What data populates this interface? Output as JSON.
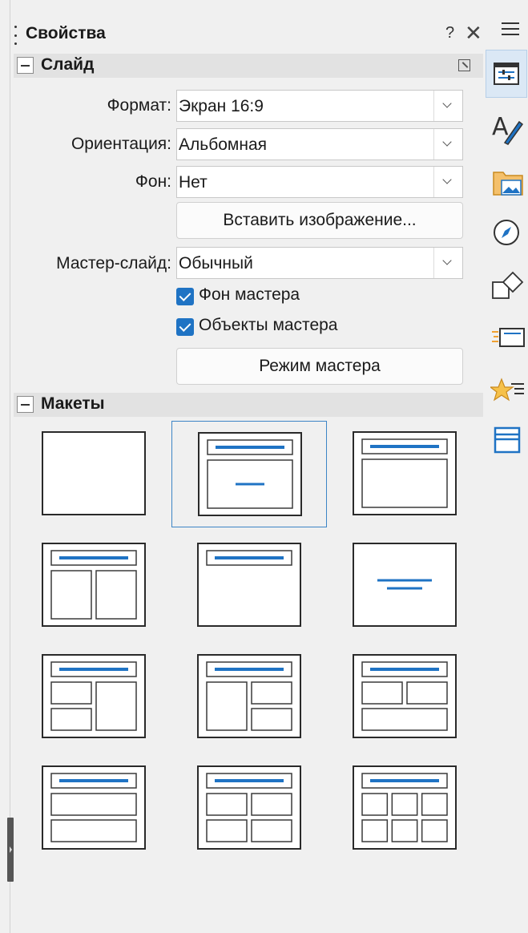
{
  "panel": {
    "title": "Свойства",
    "help": "?",
    "close": "✕"
  },
  "slide_section": {
    "title": "Слайд",
    "format": {
      "label": "Формат:",
      "value": "Экран 16:9"
    },
    "orientation": {
      "label": "Ориентация:",
      "value": "Альбомная"
    },
    "background": {
      "label": "Фон:",
      "value": "Нет"
    },
    "insert_image_button": "Вставить изображение...",
    "master_slide": {
      "label": "Мастер-слайд:",
      "value": "Обычный"
    },
    "master_background": {
      "label": "Фон мастера",
      "checked": true
    },
    "master_objects": {
      "label": "Объекты мастера",
      "checked": true
    },
    "master_mode_button": "Режим мастера"
  },
  "layouts_section": {
    "title": "Макеты",
    "selected_index": 1,
    "layouts": [
      "blank",
      "title-content-centered",
      "title-content",
      "title-two-columns",
      "title-only",
      "centered-text",
      "title-two-left-one-right",
      "title-one-left-two-right",
      "title-two-top-one-bottom",
      "title-two-stacked",
      "title-four-boxes",
      "title-six-boxes"
    ]
  },
  "tabbar": {
    "tabs": [
      {
        "icon": "properties-icon",
        "active": true
      },
      {
        "icon": "styles-icon",
        "active": false
      },
      {
        "icon": "gallery-icon",
        "active": false
      },
      {
        "icon": "navigator-icon",
        "active": false
      },
      {
        "icon": "shapes-icon",
        "active": false
      },
      {
        "icon": "slide-transition-icon",
        "active": false
      },
      {
        "icon": "animation-icon",
        "active": false
      },
      {
        "icon": "master-slides-icon",
        "active": false
      }
    ],
    "accent": "#1f73c4"
  }
}
